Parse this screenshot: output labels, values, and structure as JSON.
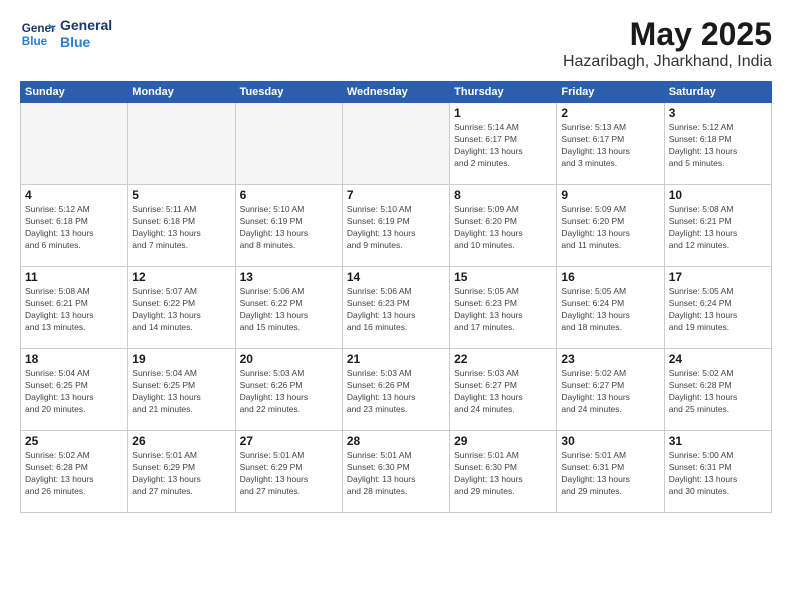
{
  "logo": {
    "line1": "General",
    "line2": "Blue"
  },
  "title": "May 2025",
  "subtitle": "Hazaribagh, Jharkhand, India",
  "days": [
    "Sunday",
    "Monday",
    "Tuesday",
    "Wednesday",
    "Thursday",
    "Friday",
    "Saturday"
  ],
  "weeks": [
    [
      {
        "day": "",
        "info": ""
      },
      {
        "day": "",
        "info": ""
      },
      {
        "day": "",
        "info": ""
      },
      {
        "day": "",
        "info": ""
      },
      {
        "day": "1",
        "info": "Sunrise: 5:14 AM\nSunset: 6:17 PM\nDaylight: 13 hours\nand 2 minutes."
      },
      {
        "day": "2",
        "info": "Sunrise: 5:13 AM\nSunset: 6:17 PM\nDaylight: 13 hours\nand 3 minutes."
      },
      {
        "day": "3",
        "info": "Sunrise: 5:12 AM\nSunset: 6:18 PM\nDaylight: 13 hours\nand 5 minutes."
      }
    ],
    [
      {
        "day": "4",
        "info": "Sunrise: 5:12 AM\nSunset: 6:18 PM\nDaylight: 13 hours\nand 6 minutes."
      },
      {
        "day": "5",
        "info": "Sunrise: 5:11 AM\nSunset: 6:18 PM\nDaylight: 13 hours\nand 7 minutes."
      },
      {
        "day": "6",
        "info": "Sunrise: 5:10 AM\nSunset: 6:19 PM\nDaylight: 13 hours\nand 8 minutes."
      },
      {
        "day": "7",
        "info": "Sunrise: 5:10 AM\nSunset: 6:19 PM\nDaylight: 13 hours\nand 9 minutes."
      },
      {
        "day": "8",
        "info": "Sunrise: 5:09 AM\nSunset: 6:20 PM\nDaylight: 13 hours\nand 10 minutes."
      },
      {
        "day": "9",
        "info": "Sunrise: 5:09 AM\nSunset: 6:20 PM\nDaylight: 13 hours\nand 11 minutes."
      },
      {
        "day": "10",
        "info": "Sunrise: 5:08 AM\nSunset: 6:21 PM\nDaylight: 13 hours\nand 12 minutes."
      }
    ],
    [
      {
        "day": "11",
        "info": "Sunrise: 5:08 AM\nSunset: 6:21 PM\nDaylight: 13 hours\nand 13 minutes."
      },
      {
        "day": "12",
        "info": "Sunrise: 5:07 AM\nSunset: 6:22 PM\nDaylight: 13 hours\nand 14 minutes."
      },
      {
        "day": "13",
        "info": "Sunrise: 5:06 AM\nSunset: 6:22 PM\nDaylight: 13 hours\nand 15 minutes."
      },
      {
        "day": "14",
        "info": "Sunrise: 5:06 AM\nSunset: 6:23 PM\nDaylight: 13 hours\nand 16 minutes."
      },
      {
        "day": "15",
        "info": "Sunrise: 5:05 AM\nSunset: 6:23 PM\nDaylight: 13 hours\nand 17 minutes."
      },
      {
        "day": "16",
        "info": "Sunrise: 5:05 AM\nSunset: 6:24 PM\nDaylight: 13 hours\nand 18 minutes."
      },
      {
        "day": "17",
        "info": "Sunrise: 5:05 AM\nSunset: 6:24 PM\nDaylight: 13 hours\nand 19 minutes."
      }
    ],
    [
      {
        "day": "18",
        "info": "Sunrise: 5:04 AM\nSunset: 6:25 PM\nDaylight: 13 hours\nand 20 minutes."
      },
      {
        "day": "19",
        "info": "Sunrise: 5:04 AM\nSunset: 6:25 PM\nDaylight: 13 hours\nand 21 minutes."
      },
      {
        "day": "20",
        "info": "Sunrise: 5:03 AM\nSunset: 6:26 PM\nDaylight: 13 hours\nand 22 minutes."
      },
      {
        "day": "21",
        "info": "Sunrise: 5:03 AM\nSunset: 6:26 PM\nDaylight: 13 hours\nand 23 minutes."
      },
      {
        "day": "22",
        "info": "Sunrise: 5:03 AM\nSunset: 6:27 PM\nDaylight: 13 hours\nand 24 minutes."
      },
      {
        "day": "23",
        "info": "Sunrise: 5:02 AM\nSunset: 6:27 PM\nDaylight: 13 hours\nand 24 minutes."
      },
      {
        "day": "24",
        "info": "Sunrise: 5:02 AM\nSunset: 6:28 PM\nDaylight: 13 hours\nand 25 minutes."
      }
    ],
    [
      {
        "day": "25",
        "info": "Sunrise: 5:02 AM\nSunset: 6:28 PM\nDaylight: 13 hours\nand 26 minutes."
      },
      {
        "day": "26",
        "info": "Sunrise: 5:01 AM\nSunset: 6:29 PM\nDaylight: 13 hours\nand 27 minutes."
      },
      {
        "day": "27",
        "info": "Sunrise: 5:01 AM\nSunset: 6:29 PM\nDaylight: 13 hours\nand 27 minutes."
      },
      {
        "day": "28",
        "info": "Sunrise: 5:01 AM\nSunset: 6:30 PM\nDaylight: 13 hours\nand 28 minutes."
      },
      {
        "day": "29",
        "info": "Sunrise: 5:01 AM\nSunset: 6:30 PM\nDaylight: 13 hours\nand 29 minutes."
      },
      {
        "day": "30",
        "info": "Sunrise: 5:01 AM\nSunset: 6:31 PM\nDaylight: 13 hours\nand 29 minutes."
      },
      {
        "day": "31",
        "info": "Sunrise: 5:00 AM\nSunset: 6:31 PM\nDaylight: 13 hours\nand 30 minutes."
      }
    ]
  ]
}
